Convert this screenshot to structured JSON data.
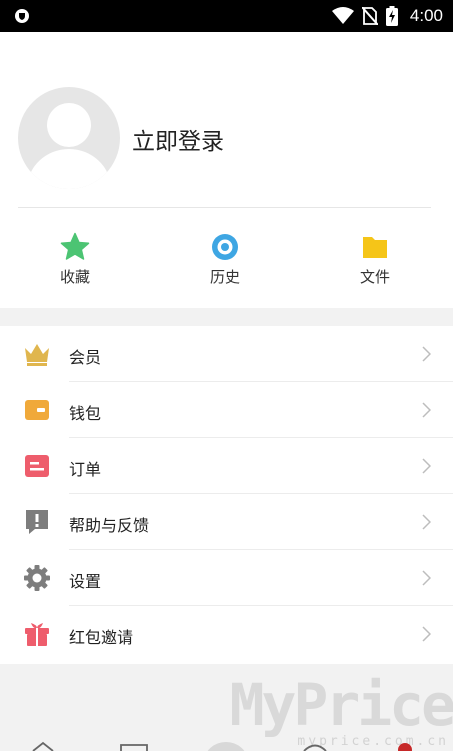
{
  "status_bar": {
    "time": "4:00",
    "icons": [
      "shield-notification-icon",
      "wifi-icon",
      "no-sim-icon",
      "battery-charging-icon"
    ]
  },
  "profile": {
    "login_text": "立即登录",
    "avatar_icon": "default-avatar-icon"
  },
  "quick_actions": [
    {
      "label": "收藏",
      "icon": "star-icon",
      "color": "#4cc473"
    },
    {
      "label": "历史",
      "icon": "eye-icon",
      "color": "#3ea6e3"
    },
    {
      "label": "文件",
      "icon": "folder-icon",
      "color": "#f5c518"
    }
  ],
  "menu": [
    {
      "label": "会员",
      "icon": "crown-icon",
      "color": "#e0b64e"
    },
    {
      "label": "钱包",
      "icon": "wallet-icon",
      "color": "#f0a93a"
    },
    {
      "label": "订单",
      "icon": "order-icon",
      "color": "#ee5d6c"
    },
    {
      "label": "帮助与反馈",
      "icon": "feedback-icon",
      "color": "#7d7d7d"
    },
    {
      "label": "设置",
      "icon": "gear-icon",
      "color": "#7d7d7d"
    },
    {
      "label": "红包邀请",
      "icon": "gift-icon",
      "color": "#ee5d6c"
    }
  ],
  "watermark": {
    "text": "MyPrice",
    "subtext": "myprice.com.cn"
  }
}
